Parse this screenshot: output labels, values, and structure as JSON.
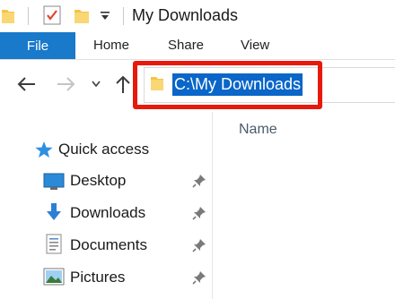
{
  "window": {
    "title": "My Downloads"
  },
  "ribbon": {
    "tabs": [
      "File",
      "Home",
      "Share",
      "View"
    ]
  },
  "address": {
    "path": "C:\\My Downloads"
  },
  "columns": {
    "name": "Name"
  },
  "nav_pane": {
    "quick_access": "Quick access",
    "items": [
      {
        "label": "Desktop",
        "icon": "desktop-icon"
      },
      {
        "label": "Downloads",
        "icon": "downloads-icon"
      },
      {
        "label": "Documents",
        "icon": "documents-icon"
      },
      {
        "label": "Pictures",
        "icon": "pictures-icon"
      }
    ]
  },
  "colors": {
    "file_tab": "#1979ca",
    "selection": "#0a66c8",
    "highlight_box": "#e8190c",
    "folder": "#f4c542"
  }
}
